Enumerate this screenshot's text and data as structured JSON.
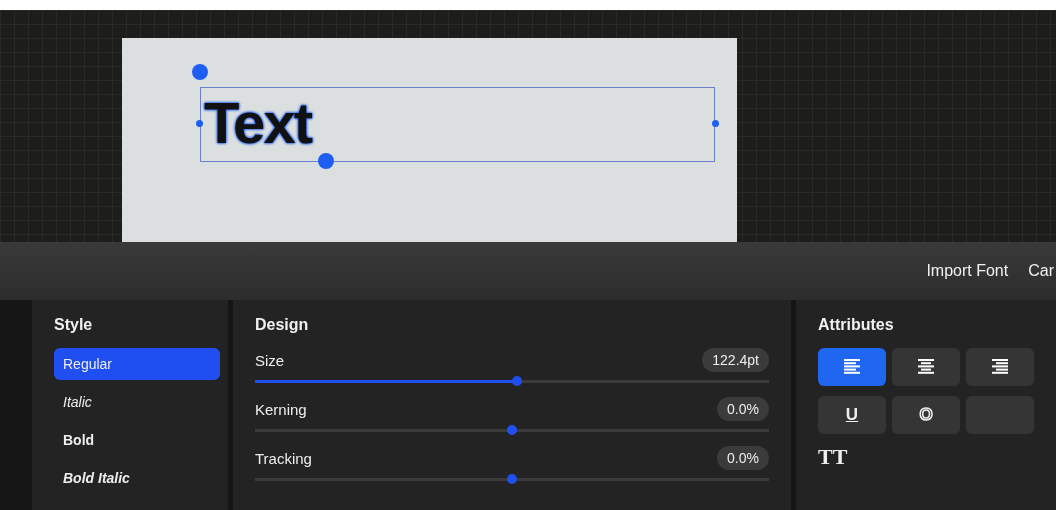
{
  "canvas": {
    "text": "Text"
  },
  "toolbar": {
    "actions": [
      "Import Font",
      "Car"
    ]
  },
  "style_panel": {
    "title": "Style",
    "items": [
      {
        "label": "Regular",
        "selected": true,
        "kind": "regular"
      },
      {
        "label": "Italic",
        "selected": false,
        "kind": "italic"
      },
      {
        "label": "Bold",
        "selected": false,
        "kind": "bold"
      },
      {
        "label": "Bold Italic",
        "selected": false,
        "kind": "bolditalic"
      }
    ]
  },
  "design_panel": {
    "title": "Design",
    "sliders": [
      {
        "label": "Size",
        "reading": "122.4pt",
        "level": 0.51
      },
      {
        "label": "Kerning",
        "reading": "0.0%",
        "level": 0.5
      },
      {
        "label": "Tracking",
        "reading": "0.0%",
        "level": 0.5
      }
    ]
  },
  "attributes_panel": {
    "title": "Attributes",
    "alignments": [
      {
        "kind": "left",
        "selected": true
      },
      {
        "kind": "center",
        "selected": false
      },
      {
        "kind": "right",
        "selected": false
      }
    ],
    "styles": [
      {
        "kind": "underline",
        "label": "U"
      },
      {
        "kind": "outline",
        "label": "O"
      },
      {
        "kind": "blank"
      }
    ],
    "case_label": "TT"
  }
}
